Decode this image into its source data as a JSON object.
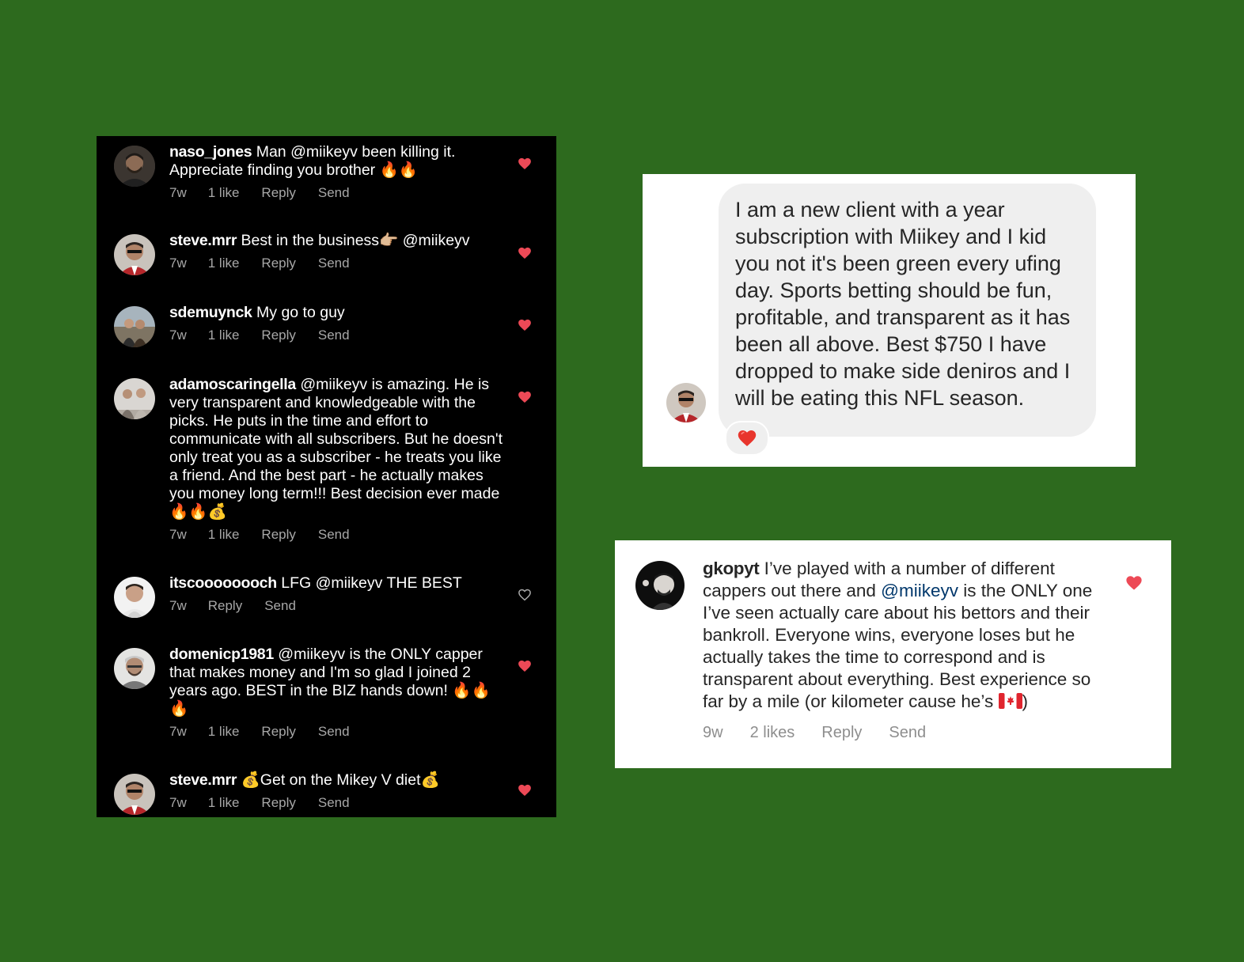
{
  "dark_comments": [
    {
      "username": "naso_jones",
      "text": "Man @miikeyv been killing it. Appreciate finding you brother 🔥🔥",
      "time": "7w",
      "likes": "1 like",
      "reply": "Reply",
      "send": "Send",
      "liked": true
    },
    {
      "username": "steve.mrr",
      "text": "Best in the business👉🏼 @miikeyv",
      "time": "7w",
      "likes": "1 like",
      "reply": "Reply",
      "send": "Send",
      "liked": true
    },
    {
      "username": "sdemuynck",
      "text": "My go to guy",
      "time": "7w",
      "likes": "1 like",
      "reply": "Reply",
      "send": "Send",
      "liked": true
    },
    {
      "username": "adamoscaringella",
      "text": "@miikeyv is amazing. He is very transparent and knowledgeable with the picks. He puts in the time and effort to communicate with all subscribers. But he doesn't only treat you as a subscriber - he treats you like a friend. And the best part - he actually makes you money long term!!! Best decision ever made 🔥🔥💰",
      "time": "7w",
      "likes": "1 like",
      "reply": "Reply",
      "send": "Send",
      "liked": true
    },
    {
      "username": "itscoooooooch",
      "text": "LFG @miikeyv THE BEST",
      "time": "7w",
      "likes": "",
      "reply": "Reply",
      "send": "Send",
      "liked": false
    },
    {
      "username": "domenicp1981",
      "text": "@miikeyv is the ONLY capper that makes money and I'm so glad I joined 2 years ago. BEST in the BIZ hands down! 🔥🔥🔥",
      "time": "7w",
      "likes": "1 like",
      "reply": "Reply",
      "send": "Send",
      "liked": true
    },
    {
      "username": "steve.mrr",
      "text": "💰Get on the Mikey V diet💰",
      "time": "7w",
      "likes": "1 like",
      "reply": "Reply",
      "send": "Send",
      "liked": true
    }
  ],
  "dm": {
    "message": "I am a new client with a year subscription with Miikey and I kid you not it's been green every ufing day. Sports betting should be fun, profitable, and transparent as it has been all above. Best $750 I have dropped to make side deniros and I will be eating this NFL season.",
    "reaction": "heart"
  },
  "gkopyt": {
    "username": "gkopyt",
    "text_before": "I’ve played with a number of different cappers out there and",
    "mention": "@miikeyv",
    "text_after": "is the ONLY one I’ve seen actually care about his bettors and their bankroll.  Everyone wins, everyone loses but he actually takes the time to correspond and is transparent about everything.  Best experience so far by a mile (or kilometer cause he’s",
    "text_end": ")",
    "time": "9w",
    "likes": "2 likes",
    "reply": "Reply",
    "send": "Send",
    "liked": true
  },
  "colors": {
    "background": "#2d6a1e",
    "heart_red": "#ed4956",
    "mention_blue": "#00376b"
  }
}
